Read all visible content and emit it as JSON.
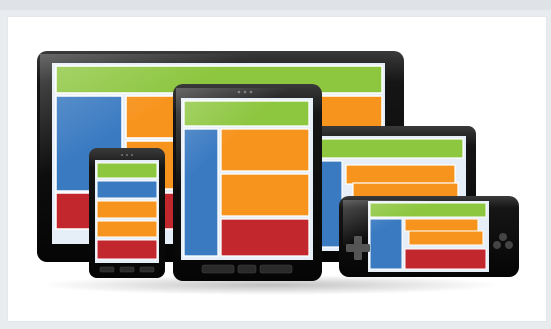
{
  "illustration": {
    "subject": "responsive-design-devices",
    "devices": [
      "desktop-monitor",
      "tablet-portrait",
      "tablet-landscape",
      "smartphone-portrait",
      "smartphone-landscape"
    ]
  },
  "colors": {
    "bezel": "#141414",
    "screen_bg": "#e6eef7",
    "header_green": "#8dc63f",
    "sidebar_blue": "#3a7ac1",
    "block_orange": "#f7941d",
    "footer_red": "#c1272d",
    "page_bg": "#e9ecef",
    "card_bg": "#ffffff"
  }
}
